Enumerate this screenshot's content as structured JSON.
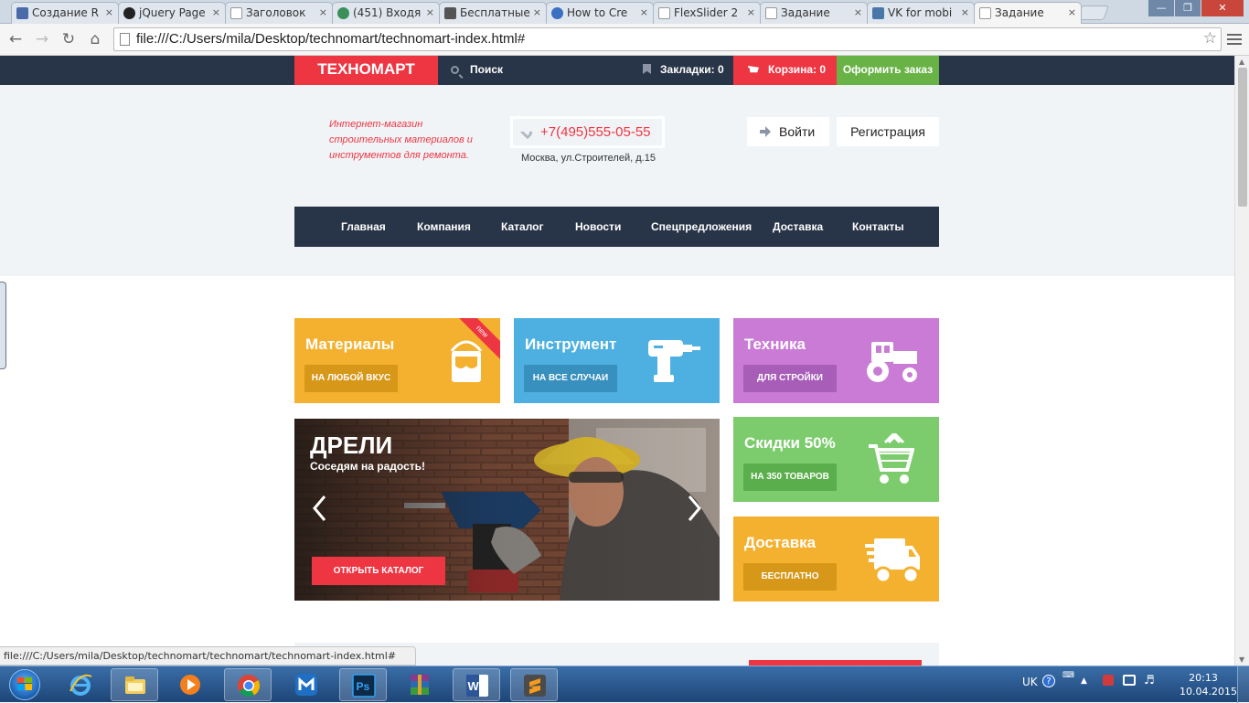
{
  "browser": {
    "tabs": [
      {
        "label": "Создание R",
        "icon_color": "#4a6aa8"
      },
      {
        "label": "jQuery Page",
        "icon_color": "#222222"
      },
      {
        "label": "Заголовок",
        "icon_color": "#999999"
      },
      {
        "label": "(451) Входя",
        "icon_color": "#3a8f5a"
      },
      {
        "label": "Бесплатные",
        "icon_color": "#555555"
      },
      {
        "label": "How to Cre",
        "icon_color": "#3b6fc2"
      },
      {
        "label": "FlexSlider 2",
        "icon_color": "#999999"
      },
      {
        "label": "Задание",
        "icon_color": "#999999"
      },
      {
        "label": "VK for mobi",
        "icon_color": "#4a76a8"
      },
      {
        "label": "Задание",
        "icon_color": "#999999"
      }
    ],
    "close_glyph": "×",
    "url": "file:///C:/Users/mila/Desktop/technomart/technomart-index.html#",
    "status_url": "file:///C:/Users/mila/Desktop/technomart/technomart/technomart-index.html#"
  },
  "site": {
    "logo": "ТЕХНОМАРТ",
    "search_label": "Поиск",
    "bookmarks_label": "Закладки: 0",
    "cart_label": "Корзина: 0",
    "order_label": "Оформить заказ",
    "tagline": "Интернет-магазин строительных материалов и инструментов для ремонта.",
    "phone": "+7(495)555-05-55",
    "address": "Москва, ул.Строителей, д.15",
    "login_label": "Войти",
    "register_label": "Регистрация",
    "nav": [
      "Главная",
      "Компания",
      "Каталог",
      "Новости",
      "Спецпредложения",
      "Доставка",
      "Контакты"
    ],
    "tiles": [
      {
        "title": "Материалы",
        "button": "НА ЛЮБОЙ ВКУС",
        "bg": "#f4b12f",
        "btn_bg": "#d79718",
        "icon": "paint-bucket-icon",
        "badge": "new"
      },
      {
        "title": "Инструмент",
        "button": "НА ВСЕ СЛУЧАИ",
        "bg": "#4eb0e0",
        "btn_bg": "#3790bd",
        "icon": "drill-icon"
      },
      {
        "title": "Техника",
        "button": "ДЛЯ СТРОЙКИ",
        "bg": "#c97bd6",
        "btn_bg": "#a85db8",
        "icon": "tractor-icon"
      },
      {
        "title": "Скидки 50%",
        "button": "НА 350 ТОВАРОВ",
        "bg": "#7ccc6d",
        "btn_bg": "#5aae4b",
        "icon": "shopping-cart-icon"
      },
      {
        "title": "Доставка",
        "button": "БЕСПЛАТНО",
        "bg": "#f4b12f",
        "btn_bg": "#d79718",
        "icon": "delivery-truck-icon"
      }
    ],
    "slider": {
      "title": "ДРЕЛИ",
      "subtitle": "Соседям на радость!",
      "button": "ОТКРЫТЬ КАТАЛОГ"
    }
  },
  "taskbar": {
    "language": "UK",
    "time": "20:13",
    "date": "10.04.2015",
    "apps": [
      "internet-explorer-icon",
      "file-explorer-icon",
      "media-player-icon",
      "chrome-icon",
      "maxthon-icon",
      "photoshop-icon",
      "winrar-icon",
      "word-icon",
      "sublime-text-icon"
    ]
  },
  "colors": {
    "brand_red": "#ee3643",
    "navy": "#283447",
    "green": "#68b246"
  }
}
